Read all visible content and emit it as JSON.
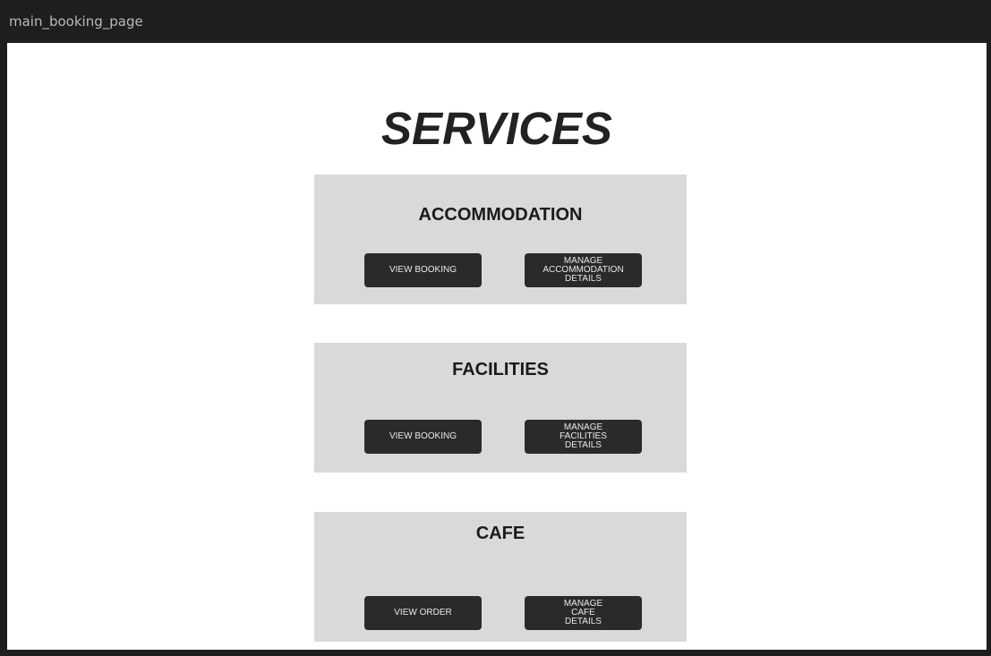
{
  "window": {
    "title": "main_booking_page"
  },
  "page": {
    "title": "SERVICES"
  },
  "services": [
    {
      "title": "ACCOMMODATION",
      "primary_button": "VIEW BOOKING",
      "secondary_button_lines": [
        "MANAGE",
        "ACCOMMODATION",
        "DETAILS"
      ]
    },
    {
      "title": "FACILITIES",
      "primary_button": "VIEW BOOKING",
      "secondary_button_lines": [
        "MANAGE",
        "FACILITIES",
        "DETAILS"
      ]
    },
    {
      "title": "CAFE",
      "primary_button": "VIEW ORDER",
      "secondary_button_lines": [
        "MANAGE",
        "CAFE",
        "DETAILS"
      ]
    }
  ],
  "colors": {
    "window_chrome": "#1e1e1e",
    "canvas": "#ffffff",
    "card": "#d9d9d9",
    "button": "#2a2a2a",
    "button_text": "#e8e8e8"
  }
}
